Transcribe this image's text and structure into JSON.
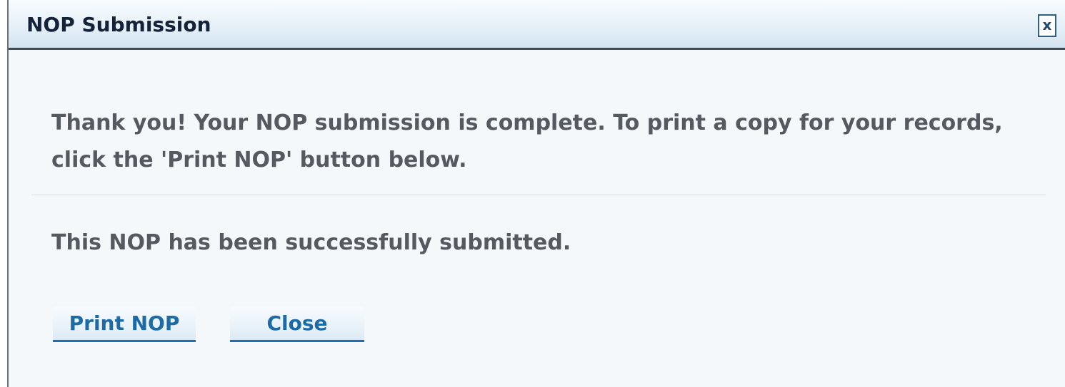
{
  "dialog": {
    "title": "NOP Submission",
    "close_glyph": "x",
    "message_primary": "Thank you! Your NOP submission is complete. To print a copy for your records, click the 'Print NOP' button below.",
    "message_status": "This NOP has been successfully submitted.",
    "buttons": {
      "print_label": "Print NOP",
      "close_label": "Close"
    }
  },
  "icons": {
    "close": "close-icon"
  },
  "colors": {
    "title_text": "#15233a",
    "body_text": "#555a60",
    "button_text": "#1c6aa6",
    "button_underline": "#1c6fb0",
    "titlebar_border": "#3c4b57",
    "background": "#f4f8fb"
  }
}
